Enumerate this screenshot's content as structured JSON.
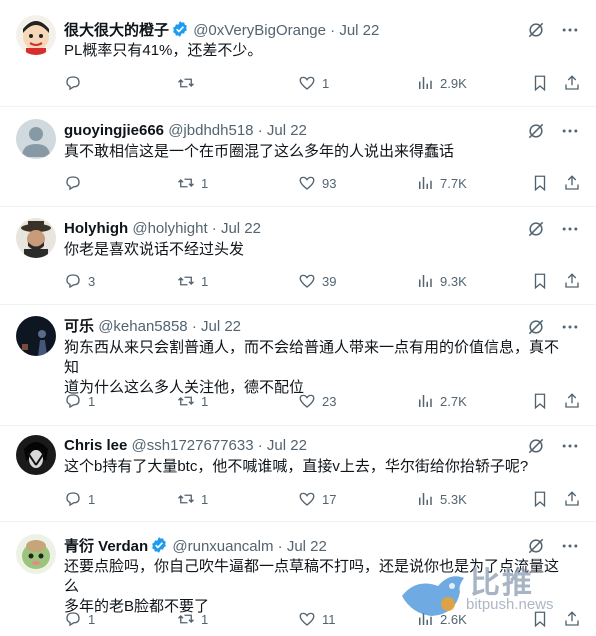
{
  "tweets": [
    {
      "name": "很大很大的橙子",
      "verified": true,
      "handle": "@0xVeryBigOrange",
      "date": "Jul 22",
      "text": "PL概率只有41%，还差不少。",
      "reply": "",
      "retweet": "",
      "like": "1",
      "views": "2.9K"
    },
    {
      "name": "guoyingjie666",
      "verified": false,
      "handle": "@jbdhdh518",
      "date": "Jul 22",
      "text": "真不敢相信这是一个在币圈混了这么多年的人说出来得蠢话",
      "reply": "",
      "retweet": "1",
      "like": "93",
      "views": "7.7K"
    },
    {
      "name": "Holyhigh",
      "verified": false,
      "handle": "@holyhight",
      "date": "Jul 22",
      "text": "你老是喜欢说话不经过头发",
      "reply": "3",
      "retweet": "1",
      "like": "39",
      "views": "9.3K"
    },
    {
      "name": "可乐",
      "verified": false,
      "handle": "@kehan5858",
      "date": "Jul 22",
      "text_lines": [
        "狗东西从来只会割普通人，而不会给普通人带来一点有用的价值信息，真不知",
        "道为什么这么多人关注他，德不配位"
      ],
      "reply": "1",
      "retweet": "1",
      "like": "23",
      "views": "2.7K"
    },
    {
      "name": "Chris lee",
      "verified": false,
      "handle": "@ssh1727677633",
      "date": "Jul 22",
      "text": "这个b持有了大量btc，他不喊谁喊，直接v上去，华尔街给你抬轿子呢?",
      "reply": "1",
      "retweet": "1",
      "like": "17",
      "views": "5.3K"
    },
    {
      "name": "青衍 Verdan",
      "verified": true,
      "handle": "@runxuancalm",
      "date": "Jul 22",
      "text_lines": [
        "还要点脸吗，你自己吹牛逼都一点草稿不打吗，还是说你也是为了点流量这么",
        "多年的老B脸都不要了"
      ],
      "reply": "1",
      "retweet": "1",
      "like": "11",
      "views": "2.6K"
    }
  ],
  "separator": "·",
  "watermark": {
    "logo_text": "比推",
    "url_text": "bitpush.news"
  },
  "colors": {
    "verified": "#1d9bf0",
    "muted": "#536471",
    "divider": "#eff3f4"
  }
}
